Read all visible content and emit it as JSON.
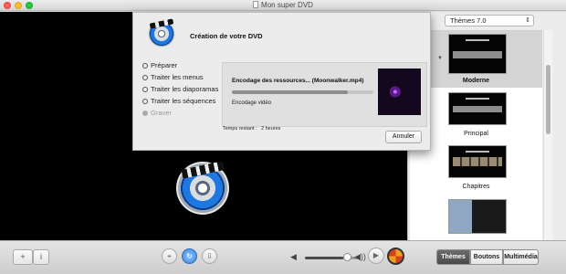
{
  "window": {
    "title": "Mon super DVD"
  },
  "dialog": {
    "title": "Création de votre DVD",
    "steps": [
      {
        "label": "Préparer",
        "enabled": true
      },
      {
        "label": "Traiter les menus",
        "enabled": true
      },
      {
        "label": "Traiter les diaporamas",
        "enabled": true
      },
      {
        "label": "Traiter les séquences",
        "enabled": true
      },
      {
        "label": "Graver",
        "enabled": false
      }
    ],
    "encoding_title": "Encodage des ressources... (Moonwalker.mp4)",
    "encoding_subtitle": "Encodage vidéo",
    "progress": 0.82,
    "time_remaining_label": "Temps restant :",
    "time_remaining_value": "2 heures",
    "cancel_label": "Annuler"
  },
  "themes": {
    "selector_label": "Thèmes 7.0",
    "items": [
      {
        "label": "Moderne",
        "selected": true
      },
      {
        "label": "Principal",
        "selected": false
      },
      {
        "label": "Chapitres",
        "selected": false
      },
      {
        "label": "",
        "selected": false
      }
    ]
  },
  "toolbar": {
    "add_label": "+",
    "info_label": "i",
    "volume": 0.7,
    "tabs": [
      {
        "label": "Thèmes",
        "active": true
      },
      {
        "label": "Boutons",
        "active": false
      },
      {
        "label": "Multimédia",
        "active": false
      }
    ]
  }
}
